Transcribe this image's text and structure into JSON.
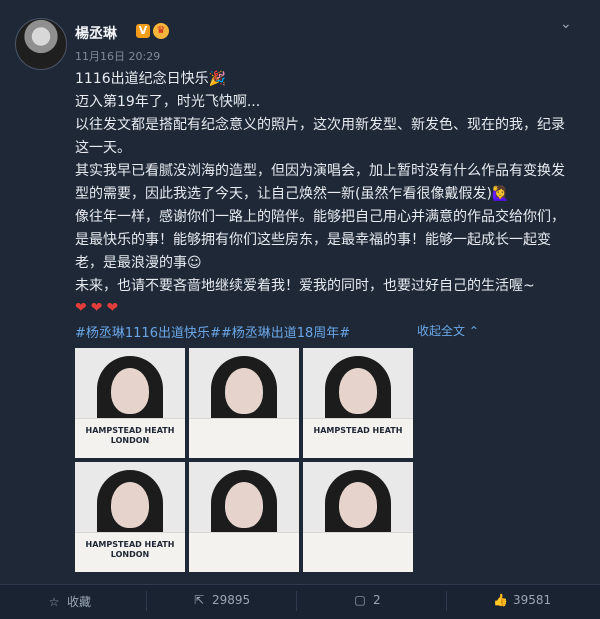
{
  "post": {
    "username": "楊丞琳",
    "verified_badge": "V",
    "time": "11月16日 20:29",
    "lines": [
      "1116出道纪念日快乐🎉",
      "迈入第19年了，时光飞快啊...",
      "以往发文都是搭配有纪念意义的照片，这次用新发型、新发色、现在的我，纪录",
      "这一天。",
      "其实我早已看腻没浏海的造型，但因为演唱会，加上暂时没有什么作品有变换发",
      "型的需要，因此我选了今天，让自己焕然一新(虽然乍看很像戴假发)🙋‍♀️",
      "像往年一样，感谢你们一路上的陪伴。能够把自己用心并满意的作品交给你们，",
      "是最快乐的事！能够拥有你们这些房东，是最幸福的事！能够一起成长一起变",
      "老，是最浪漫的事☺",
      "未来，也请不要吝啬地继续爱着我！爱我的同时，也要过好自己的生活喔~"
    ],
    "hearts": "❤❤❤",
    "hashtags": "#杨丞琳1116出道快乐##杨丞琳出道18周年#",
    "collapse_label": "收起全文",
    "photos": [
      {
        "print": "HAMPSTEAD HEATH LONDON"
      },
      {
        "print": ""
      },
      {
        "print": "HAMPSTEAD HEATH"
      },
      {
        "print": "HAMPSTEAD HEATH LONDON"
      },
      {
        "print": ""
      },
      {
        "print": ""
      }
    ]
  },
  "actions": {
    "favorite": {
      "label": "收藏",
      "icon": "star-icon"
    },
    "repost": {
      "count": "29895",
      "icon": "repost-icon"
    },
    "comment": {
      "count": "2",
      "icon": "comment-icon"
    },
    "like": {
      "count": "39581",
      "icon": "thumbs-up-icon"
    }
  },
  "colors": {
    "background": "#1e2836",
    "link": "#6aa7e8",
    "heart": "#e23d3d",
    "badge": "#f29d1b"
  }
}
